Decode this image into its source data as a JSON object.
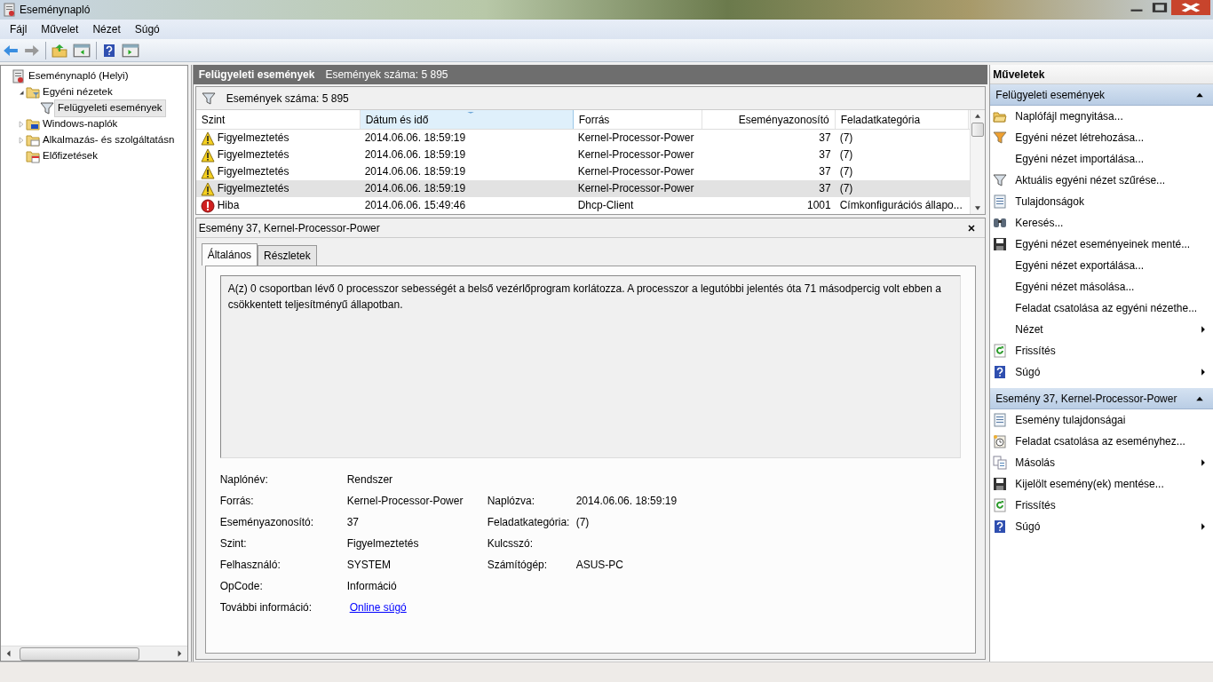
{
  "window": {
    "title": "Eseménynapló"
  },
  "menu": [
    "Fájl",
    "Művelet",
    "Nézet",
    "Súgó"
  ],
  "tree": [
    {
      "label": "Eseménynapló (Helyi)",
      "selected": false,
      "children": [
        {
          "label": "Egyéni nézetek",
          "expanded": true,
          "selected": false,
          "children": [
            {
              "label": "Felügyeleti események",
              "selected": true
            }
          ]
        },
        {
          "label": "Windows-naplók",
          "expanded": false,
          "selected": false
        },
        {
          "label": "Alkalmazás- és szolgáltatásn",
          "expanded": false,
          "selected": false
        },
        {
          "label": "Előfizetések",
          "selected": false
        }
      ]
    }
  ],
  "center": {
    "title": "Felügyeleti események",
    "count": "Események száma: 5 895",
    "filter_text": "Események száma: 5 895",
    "columns": [
      {
        "label": "Szint",
        "sorted": false
      },
      {
        "label": "Dátum és idő",
        "sorted": true
      },
      {
        "label": "Forrás",
        "sorted": false
      },
      {
        "label": "Eseményazonosító",
        "sorted": false
      },
      {
        "label": "Feladatkategória",
        "sorted": false
      }
    ],
    "rows": [
      {
        "kind": "warning",
        "selected": false,
        "cells": [
          "Figyelmeztetés",
          "2014.06.06. 18:59:19",
          "Kernel-Processor-Power",
          "37",
          "(7)"
        ]
      },
      {
        "kind": "warning",
        "selected": false,
        "cells": [
          "Figyelmeztetés",
          "2014.06.06. 18:59:19",
          "Kernel-Processor-Power",
          "37",
          "(7)"
        ]
      },
      {
        "kind": "warning",
        "selected": false,
        "cells": [
          "Figyelmeztetés",
          "2014.06.06. 18:59:19",
          "Kernel-Processor-Power",
          "37",
          "(7)"
        ]
      },
      {
        "kind": "warning",
        "selected": true,
        "cells": [
          "Figyelmeztetés",
          "2014.06.06. 18:59:19",
          "Kernel-Processor-Power",
          "37",
          "(7)"
        ]
      },
      {
        "kind": "error",
        "selected": false,
        "cells": [
          "Hiba",
          "2014.06.06. 15:49:46",
          "Dhcp-Client",
          "1001",
          "Címkonfigurációs állapo..."
        ]
      }
    ]
  },
  "detail": {
    "title": "Esemény 37, Kernel-Processor-Power",
    "tabs": [
      {
        "label": "Általános",
        "selected": true
      },
      {
        "label": "Részletek",
        "selected": false
      }
    ],
    "description": "A(z) 0 csoportban lévő 0 processzor sebességét a belső vezérlőprogram korlátozza. A processzor a legutóbbi jelentés óta 71 másodpercig volt ebben a csökkentett teljesítményű állapotban.",
    "fields": [
      {
        "label": "Naplónév:",
        "value": "Rendszer"
      },
      {
        "label": "Forrás:",
        "value": "Kernel-Processor-Power",
        "label2": "Naplózva:",
        "value2": "2014.06.06. 18:59:19"
      },
      {
        "label": "Eseményazonosító:",
        "value": "37",
        "label2": "Feladatkategória:",
        "value2": "(7)"
      },
      {
        "label": "Szint:",
        "value": "Figyelmeztetés",
        "label2": "Kulcsszó:"
      },
      {
        "label": "Felhasználó:",
        "value": "SYSTEM",
        "label2": "Számítógép:",
        "value2": "ASUS-PC"
      },
      {
        "label": "OpCode:",
        "value": "Információ"
      },
      {
        "label": "További információ:",
        "link": "Online súgó"
      }
    ]
  },
  "actions": {
    "title": "Műveletek",
    "sections": [
      {
        "title": "Felügyeleti események",
        "items": [
          {
            "label": "Naplófájl megnyitása...",
            "submenu": false
          },
          {
            "label": "Egyéni nézet létrehozása...",
            "submenu": false
          },
          {
            "label": "Egyéni nézet importálása...",
            "submenu": false
          },
          {
            "label": "Aktuális egyéni nézet szűrése...",
            "submenu": false
          },
          {
            "label": "Tulajdonságok",
            "submenu": false
          },
          {
            "label": "Keresés...",
            "submenu": false
          },
          {
            "label": "Egyéni nézet eseményeinek menté...",
            "submenu": false
          },
          {
            "label": "Egyéni nézet exportálása...",
            "submenu": false
          },
          {
            "label": "Egyéni nézet másolása...",
            "submenu": false
          },
          {
            "label": "Feladat csatolása az egyéni nézethe...",
            "submenu": false
          },
          {
            "label": "Nézet",
            "submenu": true
          },
          {
            "label": "Frissítés",
            "submenu": false
          },
          {
            "label": "Súgó",
            "submenu": true
          }
        ]
      },
      {
        "title": "Esemény 37, Kernel-Processor-Power",
        "items": [
          {
            "label": "Esemény tulajdonságai",
            "submenu": false
          },
          {
            "label": "Feladat csatolása az eseményhez...",
            "submenu": false
          },
          {
            "label": "Másolás",
            "submenu": true
          },
          {
            "label": "Kijelölt esemény(ek) mentése...",
            "submenu": false
          },
          {
            "label": "Frissítés",
            "submenu": false
          },
          {
            "label": "Súgó",
            "submenu": true
          }
        ]
      }
    ]
  }
}
